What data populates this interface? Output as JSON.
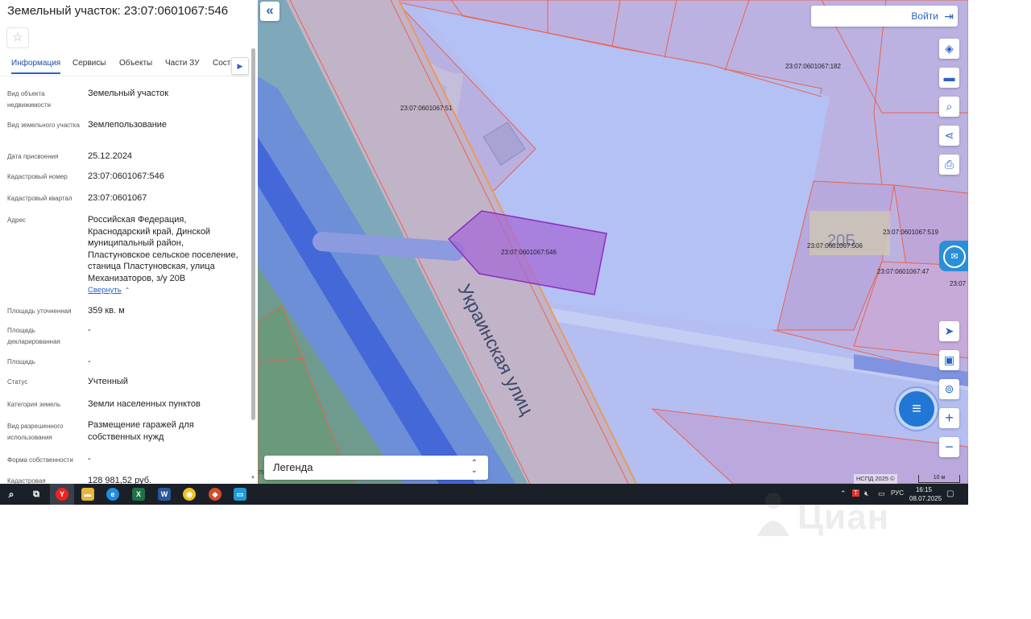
{
  "panel": {
    "title": "Земельный участок: 23:07:0601067:546",
    "tabs": [
      "Информация",
      "Сервисы",
      "Объекты",
      "Части ЗУ",
      "Соста"
    ],
    "tab_next_icon": "chevron-right-icon",
    "fields": [
      {
        "label": "Вид объекта недвижимости",
        "value": "Земельный участок"
      },
      {
        "label": "Вид земельного участка",
        "value": "Землепользование"
      },
      {
        "label": "Дата присвоения",
        "value": "25.12.2024"
      },
      {
        "label": "Кадастровый номер",
        "value": "23:07:0601067:546"
      },
      {
        "label": "Кадастровый квартал",
        "value": "23:07:0601067"
      },
      {
        "label": "Адрес",
        "value": "Российская Федерация, Краснодарский край, Динской муниципальный район, Пластуновское сельское поселение, станица Пластуновская, улица Механизаторов, з/у 20В"
      },
      {
        "label": "Площадь уточненная",
        "value": "359 кв. м"
      },
      {
        "label": "Площадь декларированная",
        "value": "-"
      },
      {
        "label": "Площадь",
        "value": "-"
      },
      {
        "label": "Статус",
        "value": "Учтенный"
      },
      {
        "label": "Категория земель",
        "value": "Земли населенных пунктов"
      },
      {
        "label": "Вид разрешенного использования",
        "value": "Размещение гаражей для собственных нужд"
      },
      {
        "label": "Форма собственности",
        "value": "-"
      },
      {
        "label": "Кадастровая",
        "value": "128 981,52 руб."
      }
    ],
    "collapse_label": "Свернуть"
  },
  "map": {
    "login_label": "Войти",
    "parcel_labels": {
      "p182": "23:07:0601067:182",
      "p51": "23:07:0601067:51",
      "p546": "23:07:0601067:546",
      "p519": "23:07:0601067:519",
      "p506": "23:07:0601067:506",
      "p47": "23:07:0601067:47",
      "p23edge": "23:07"
    },
    "street_label": "Украинская улиц",
    "building_number": "20Б",
    "legend_label": "Легенда",
    "attribution": "НСПД 2025 ©",
    "scale_label": "10 м",
    "edge_coord": "75",
    "selected_color": "#a46ad6",
    "tools": [
      "layers-icon",
      "ruler-icon",
      "area-search-icon",
      "share-icon",
      "print-icon",
      "locate-icon",
      "minimap-icon",
      "pin-icon",
      "zoom-in-icon",
      "zoom-out-icon"
    ]
  },
  "taskbar": {
    "tray_lang": "РУС",
    "time": "16:15",
    "date": "08.07.2025"
  },
  "watermark": {
    "text": "Циан"
  }
}
